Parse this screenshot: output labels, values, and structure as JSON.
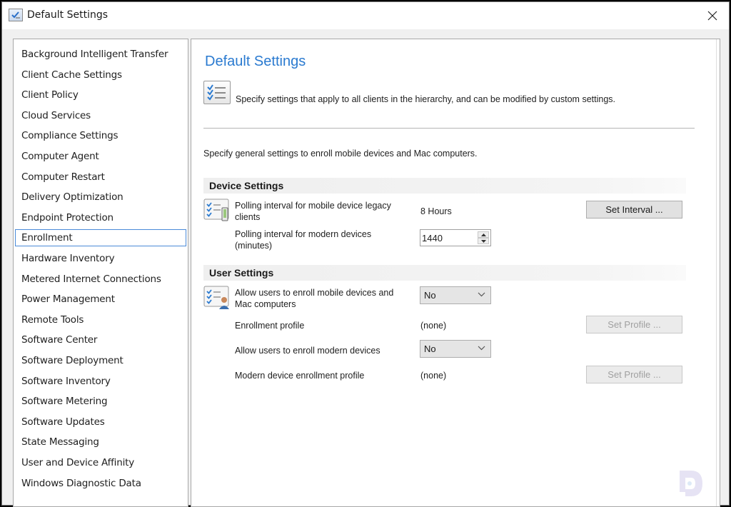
{
  "window": {
    "title": "Default Settings",
    "close_label": "Close"
  },
  "sidebar": {
    "selected": "Enrollment",
    "items": [
      {
        "label": "Background Intelligent Transfer"
      },
      {
        "label": "Client Cache Settings"
      },
      {
        "label": "Client Policy"
      },
      {
        "label": "Cloud Services"
      },
      {
        "label": "Compliance Settings"
      },
      {
        "label": "Computer Agent"
      },
      {
        "label": "Computer Restart"
      },
      {
        "label": "Delivery Optimization"
      },
      {
        "label": "Endpoint Protection"
      },
      {
        "label": "Enrollment"
      },
      {
        "label": "Hardware Inventory"
      },
      {
        "label": "Metered Internet Connections"
      },
      {
        "label": "Power Management"
      },
      {
        "label": "Remote Tools"
      },
      {
        "label": "Software Center"
      },
      {
        "label": "Software Deployment"
      },
      {
        "label": "Software Inventory"
      },
      {
        "label": "Software Metering"
      },
      {
        "label": "Software Updates"
      },
      {
        "label": "State Messaging"
      },
      {
        "label": "User and Device Affinity"
      },
      {
        "label": "Windows Diagnostic Data"
      }
    ]
  },
  "main": {
    "title": "Default Settings",
    "description": "Specify settings that apply to all clients in the hierarchy, and can be modified by custom settings.",
    "subdescription": "Specify general settings to enroll mobile devices and Mac computers.",
    "device_settings": {
      "header": "Device Settings",
      "legacy_polling_label": "Polling interval for mobile device legacy clients",
      "legacy_polling_value": "8 Hours",
      "set_interval_label": "Set Interval ...",
      "modern_polling_label": "Polling interval for modern devices (minutes)",
      "modern_polling_value": "1440"
    },
    "user_settings": {
      "header": "User Settings",
      "allow_mobile_label": "Allow users to enroll mobile devices and Mac computers",
      "allow_mobile_value": "No",
      "enrollment_profile_label": "Enrollment profile",
      "enrollment_profile_value": "(none)",
      "set_profile_label_1": "Set Profile ...",
      "allow_modern_label": "Allow users to enroll modern devices",
      "allow_modern_value": "No",
      "modern_profile_label": "Modern device enrollment profile",
      "modern_profile_value": "(none)",
      "set_profile_label_2": "Set Profile ..."
    }
  },
  "colors": {
    "title_blue": "#2a7ad0",
    "selection_border": "#4a8ad8"
  }
}
